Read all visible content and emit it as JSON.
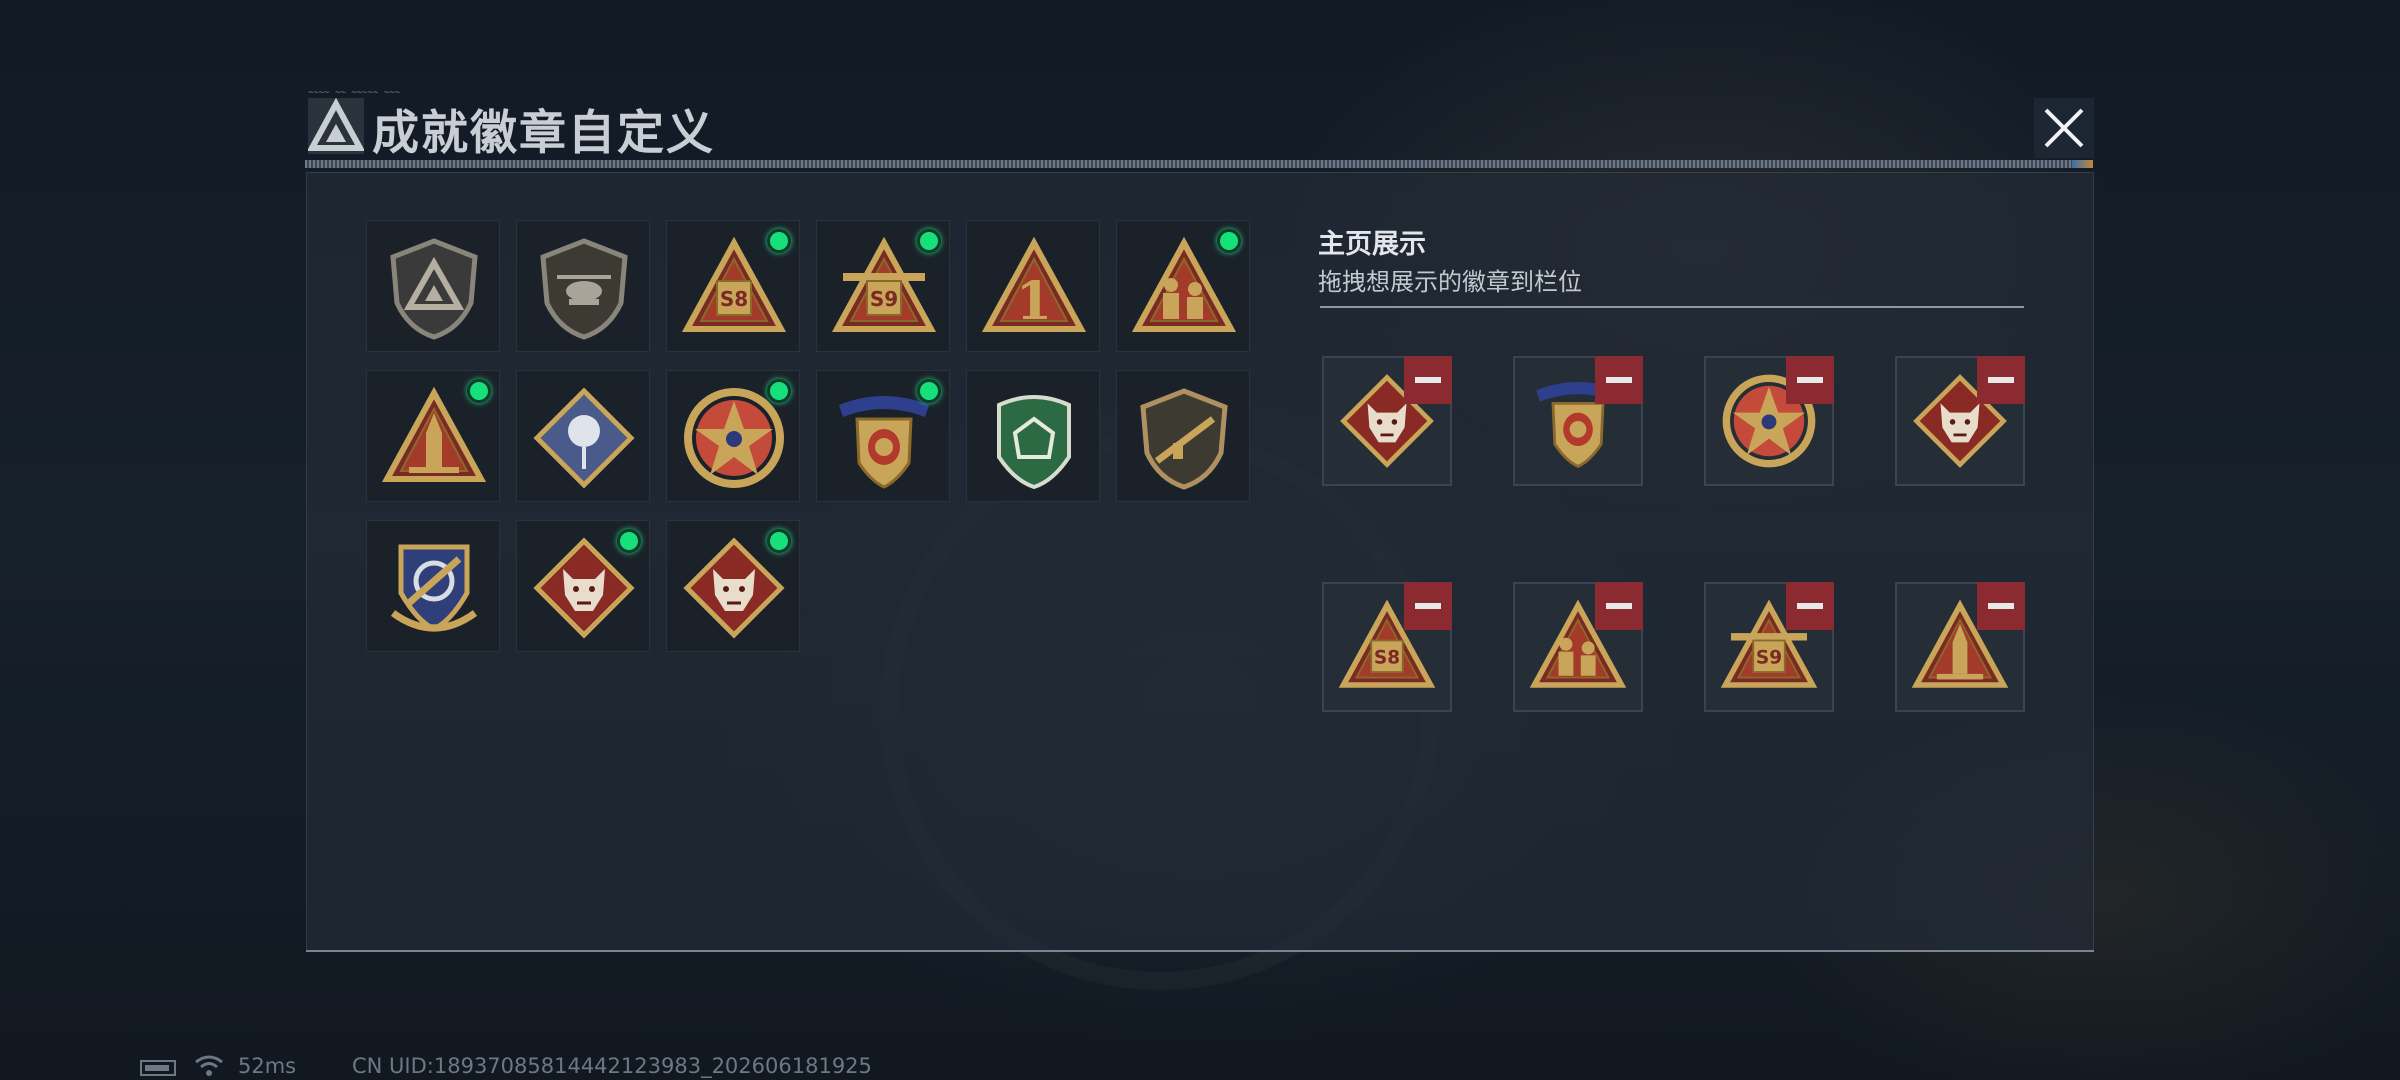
{
  "header": {
    "title": "成就徽章自定义",
    "small_caption": "~~~~ ~~ ~~~~~ ~~~"
  },
  "grid": {
    "badges": [
      {
        "icon": "grey-triangle-shield-badge-icon",
        "new": false
      },
      {
        "icon": "helicopter-shield-badge-icon",
        "new": false
      },
      {
        "icon": "s8-triangle-badge-icon",
        "new": true,
        "label": "S8"
      },
      {
        "icon": "s9-triangle-wings-badge-icon",
        "new": true,
        "label": "S9"
      },
      {
        "icon": "number-one-triangle-badge-icon",
        "new": false,
        "label": "1"
      },
      {
        "icon": "soldiers-triangle-badge-icon",
        "new": true
      },
      {
        "icon": "rocket-triangle-badge-icon",
        "new": true
      },
      {
        "icon": "rose-diamond-badge-icon",
        "new": false
      },
      {
        "icon": "star-wreath-medal-icon",
        "new": true
      },
      {
        "icon": "stars-banner-shield-badge-icon",
        "new": true
      },
      {
        "icon": "green-gem-shield-badge-icon",
        "new": false
      },
      {
        "icon": "rifle-shield-badge-icon",
        "new": false
      },
      {
        "icon": "blue-sword-shield-badge-icon",
        "new": false
      },
      {
        "icon": "wolf-diamond-badge-icon",
        "new": true
      },
      {
        "icon": "wolf-diamond-badge-icon",
        "new": true
      }
    ]
  },
  "display": {
    "title": "主页展示",
    "subtitle": "拖拽想展示的徽章到栏位",
    "slots": [
      {
        "icon": "wolf-diamond-badge-icon"
      },
      {
        "icon": "stars-banner-shield-badge-icon"
      },
      {
        "icon": "star-wreath-medal-icon"
      },
      {
        "icon": "wolf-diamond-badge-icon"
      },
      {
        "icon": "s8-triangle-badge-icon",
        "label": "S8"
      },
      {
        "icon": "soldiers-triangle-badge-icon"
      },
      {
        "icon": "s9-triangle-wings-badge-icon",
        "label": "S9"
      },
      {
        "icon": "rocket-triangle-badge-icon"
      }
    ]
  },
  "footer": {
    "ping": "52ms",
    "uid": "CN UID:18937085814442123983_202606181925"
  },
  "colors": {
    "new_dot": "#15e07a",
    "remove_button": "#8b2a31",
    "gold": "#c9a55a"
  }
}
